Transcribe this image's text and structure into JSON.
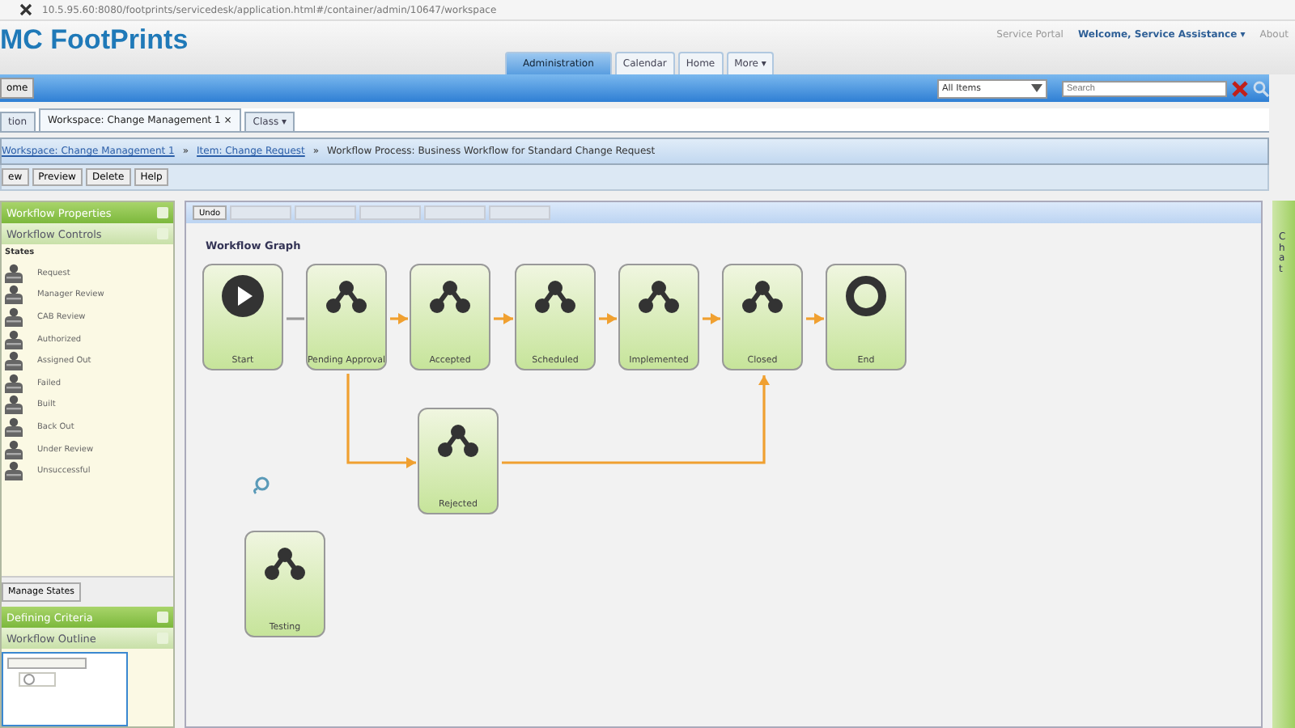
{
  "address_bar": {
    "url": "10.5.95.60:8080/footprints/servicedesk/application.html#/container/admin/10647/workspace"
  },
  "header": {
    "logo": "MC FootPrints",
    "links": [
      "Service Portal",
      "Welcome, Service Assistance ▾",
      "About"
    ]
  },
  "main_tabs": [
    {
      "label": "Administration",
      "selected": true
    },
    {
      "label": "Calendar",
      "selected": false
    },
    {
      "label": "Home",
      "selected": false
    },
    {
      "label": "More ▾",
      "selected": false
    }
  ],
  "blue_bar": {
    "button": "ome",
    "scope": "All Items",
    "search": {
      "placeholder": "Search"
    }
  },
  "doc_tabs": [
    {
      "label": "tion",
      "selected": false
    },
    {
      "label": "Workspace: Change Management 1 ×",
      "selected": true
    },
    {
      "label": "Class ▾",
      "selected": false
    }
  ],
  "breadcrumb_separator": "»",
  "breadcrumb": [
    {
      "text": "Workspace: Change Management 1",
      "link": true
    },
    {
      "text": "Item: Change Request",
      "link": true
    },
    {
      "text": "Workflow Process: Business Workflow for Standard Change Request",
      "link": false
    }
  ],
  "actions": [
    "ew",
    "Preview",
    "Delete",
    "Help"
  ],
  "sidebar": {
    "properties_header": "Workflow Properties",
    "controls_header": "Workflow Controls",
    "states_label": "States",
    "states": [
      "Request",
      "Manager Review",
      "CAB Review",
      "Authorized",
      "Assigned Out",
      "Failed",
      "Built",
      "Back Out",
      "Under Review",
      "Unsuccessful"
    ],
    "manage_button": "Manage States",
    "criteria_header": "Defining Criteria",
    "outline_header": "Workflow Outline"
  },
  "graph_toolbar": [
    {
      "label": "Undo",
      "disabled": false
    },
    {
      "disabled": true
    },
    {
      "disabled": true
    },
    {
      "disabled": true
    },
    {
      "disabled": true
    },
    {
      "disabled": true
    }
  ],
  "graph": {
    "title": "Workflow Graph",
    "nodes": [
      {
        "label": "Start",
        "kind": "start"
      },
      {
        "label": "Pending Approval",
        "kind": "state"
      },
      {
        "label": "Accepted",
        "kind": "state"
      },
      {
        "label": "Scheduled",
        "kind": "state"
      },
      {
        "label": "Implemented",
        "kind": "state"
      },
      {
        "label": "Closed",
        "kind": "state"
      },
      {
        "label": "End",
        "kind": "end"
      },
      {
        "label": "Rejected",
        "kind": "state"
      },
      {
        "label": "Testing",
        "kind": "state"
      }
    ]
  },
  "side_strip": {
    "label": "Chat"
  }
}
